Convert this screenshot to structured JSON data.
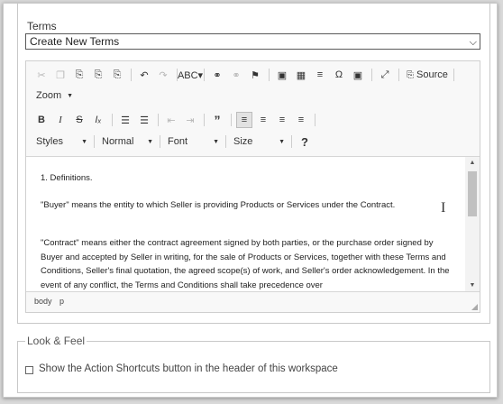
{
  "terms": {
    "label": "Terms",
    "selected": "Create New Terms",
    "chevron": "⌵"
  },
  "toolbar": {
    "row1": [
      {
        "name": "cut-icon",
        "glyph": "✂",
        "disabled": true
      },
      {
        "name": "copy-icon",
        "glyph": "❐",
        "disabled": true
      },
      {
        "name": "paste-icon",
        "glyph": "⎘",
        "disabled": false
      },
      {
        "name": "paste-text-icon",
        "glyph": "⎘",
        "disabled": false
      },
      {
        "name": "paste-word-icon",
        "glyph": "⎘",
        "disabled": false
      },
      {
        "sep": true
      },
      {
        "name": "undo-icon",
        "glyph": "↶",
        "disabled": false
      },
      {
        "name": "redo-icon",
        "glyph": "↷",
        "disabled": true
      },
      {
        "sep": true
      },
      {
        "name": "spellcheck-icon",
        "glyph": "ABC▾",
        "disabled": false
      },
      {
        "sep": true
      },
      {
        "name": "link-icon",
        "glyph": "⚭",
        "disabled": false
      },
      {
        "name": "unlink-icon",
        "glyph": "⚭",
        "disabled": true
      },
      {
        "name": "anchor-flag-icon",
        "glyph": "⚑",
        "disabled": false
      },
      {
        "sep": true
      },
      {
        "name": "image-icon",
        "glyph": "▣",
        "disabled": false
      },
      {
        "name": "table-icon",
        "glyph": "▦",
        "disabled": false
      },
      {
        "name": "horizontal-line-icon",
        "glyph": "≡",
        "disabled": false
      },
      {
        "name": "special-char-icon",
        "glyph": "Ω",
        "disabled": false
      },
      {
        "name": "image2-icon",
        "glyph": "▣",
        "disabled": false
      },
      {
        "sep": true
      },
      {
        "name": "maximize-icon",
        "glyph": "⤢",
        "disabled": false
      },
      {
        "sep": true
      }
    ],
    "source_label": "Source",
    "zoom_label": "Zoom",
    "row3": [
      {
        "name": "bold-icon",
        "glyph": "B",
        "disabled": false,
        "style": "font-weight:bold;"
      },
      {
        "name": "italic-icon",
        "glyph": "I",
        "disabled": false,
        "style": "font-style:italic;font-family:'Liberation Serif',serif;"
      },
      {
        "name": "strikethrough-icon",
        "glyph": "S",
        "disabled": false,
        "style": "text-decoration:line-through;"
      },
      {
        "name": "remove-format-icon",
        "glyph": "Iₓ",
        "disabled": false,
        "style": "font-style:italic;"
      },
      {
        "sep": true
      },
      {
        "name": "numbered-list-icon",
        "glyph": "☰",
        "disabled": false
      },
      {
        "name": "bulleted-list-icon",
        "glyph": "☰",
        "disabled": false
      },
      {
        "sep": true
      },
      {
        "name": "outdent-icon",
        "glyph": "⇤",
        "disabled": true
      },
      {
        "name": "indent-icon",
        "glyph": "⇥",
        "disabled": true
      },
      {
        "sep": true
      },
      {
        "name": "blockquote-icon",
        "glyph": "”",
        "disabled": false,
        "style": "font-weight:bold;font-size:14px;"
      },
      {
        "sep": true
      },
      {
        "name": "align-left-icon",
        "glyph": "≡",
        "disabled": false,
        "active": true
      },
      {
        "name": "align-center-icon",
        "glyph": "≡",
        "disabled": false
      },
      {
        "name": "align-right-icon",
        "glyph": "≡",
        "disabled": false
      },
      {
        "name": "justify-icon",
        "glyph": "≡",
        "disabled": false
      },
      {
        "sep": true
      }
    ],
    "styles_label": "Styles",
    "format_label": "Normal",
    "font_label": "Font",
    "size_label": "Size",
    "help_glyph": "?"
  },
  "content": {
    "p1": "1. Definitions.",
    "p2": "\"Buyer\" means the entity to which Seller is providing Products or Services under the Contract.",
    "p3": "\"Contract\" means either the contract agreement signed by both parties, or the purchase order signed by Buyer and accepted by Seller in writing, for the sale of Products or Services, together with these Terms and Conditions, Seller's final quotation, the agreed scope(s) of work, and Seller's order acknowledgement. In the event of any conflict, the Terms and Conditions shall take precedence over"
  },
  "statusbar": {
    "path1": "body",
    "path2": "p"
  },
  "look_feel": {
    "legend": "Look & Feel",
    "checkbox_label": "Show the Action Shortcuts button in the header of this workspace",
    "checked": false
  }
}
